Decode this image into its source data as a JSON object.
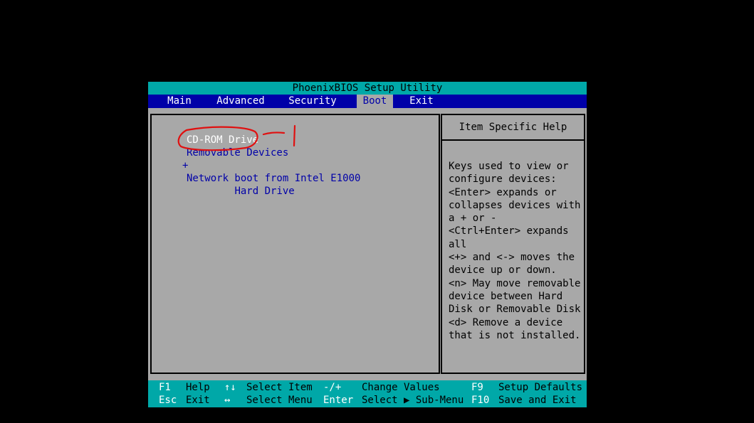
{
  "title": "PhoenixBIOS Setup Utility",
  "menu": [
    {
      "label": "Main",
      "active": false
    },
    {
      "label": "Advanced",
      "active": false
    },
    {
      "label": "Security",
      "active": false
    },
    {
      "label": "Boot",
      "active": true
    },
    {
      "label": "Exit",
      "active": false
    }
  ],
  "boot_items": [
    {
      "label": "CD-ROM Drive",
      "selected": true,
      "expandable": false
    },
    {
      "label": "Removable Devices",
      "selected": false,
      "expandable": false
    },
    {
      "label": "Hard Drive",
      "selected": false,
      "expandable": true,
      "marker": "+"
    },
    {
      "label": "Network boot from Intel E1000",
      "selected": false,
      "expandable": false
    }
  ],
  "help": {
    "title": "Item Specific Help",
    "body": "Keys used to view or\nconfigure devices:\n<Enter> expands or\ncollapses devices with\na + or -\n<Ctrl+Enter> expands\nall\n<+> and <-> moves the\ndevice up or down.\n<n> May move removable\ndevice between Hard\nDisk or Removable Disk\n<d> Remove a device\nthat is not installed."
  },
  "status_bar": {
    "row1": [
      {
        "key": "F1",
        "action": "Help"
      },
      {
        "key": "↑↓",
        "action": "Select Item"
      },
      {
        "key": "-/+",
        "action": "Change Values"
      },
      {
        "key": "F9",
        "action": "Setup Defaults"
      }
    ],
    "row2": [
      {
        "key": "Esc",
        "action": "Exit"
      },
      {
        "key": "↔",
        "action": "Select Menu"
      },
      {
        "key": "Enter",
        "action": "Select ▶ Sub-Menu"
      },
      {
        "key": "F10",
        "action": "Save and Exit"
      }
    ]
  },
  "colors": {
    "background": "#000000",
    "panel": "#a8a8a8",
    "title_bar": "#00a8a8",
    "menu_bar": "#0000a8",
    "annotation": "#e01010"
  }
}
